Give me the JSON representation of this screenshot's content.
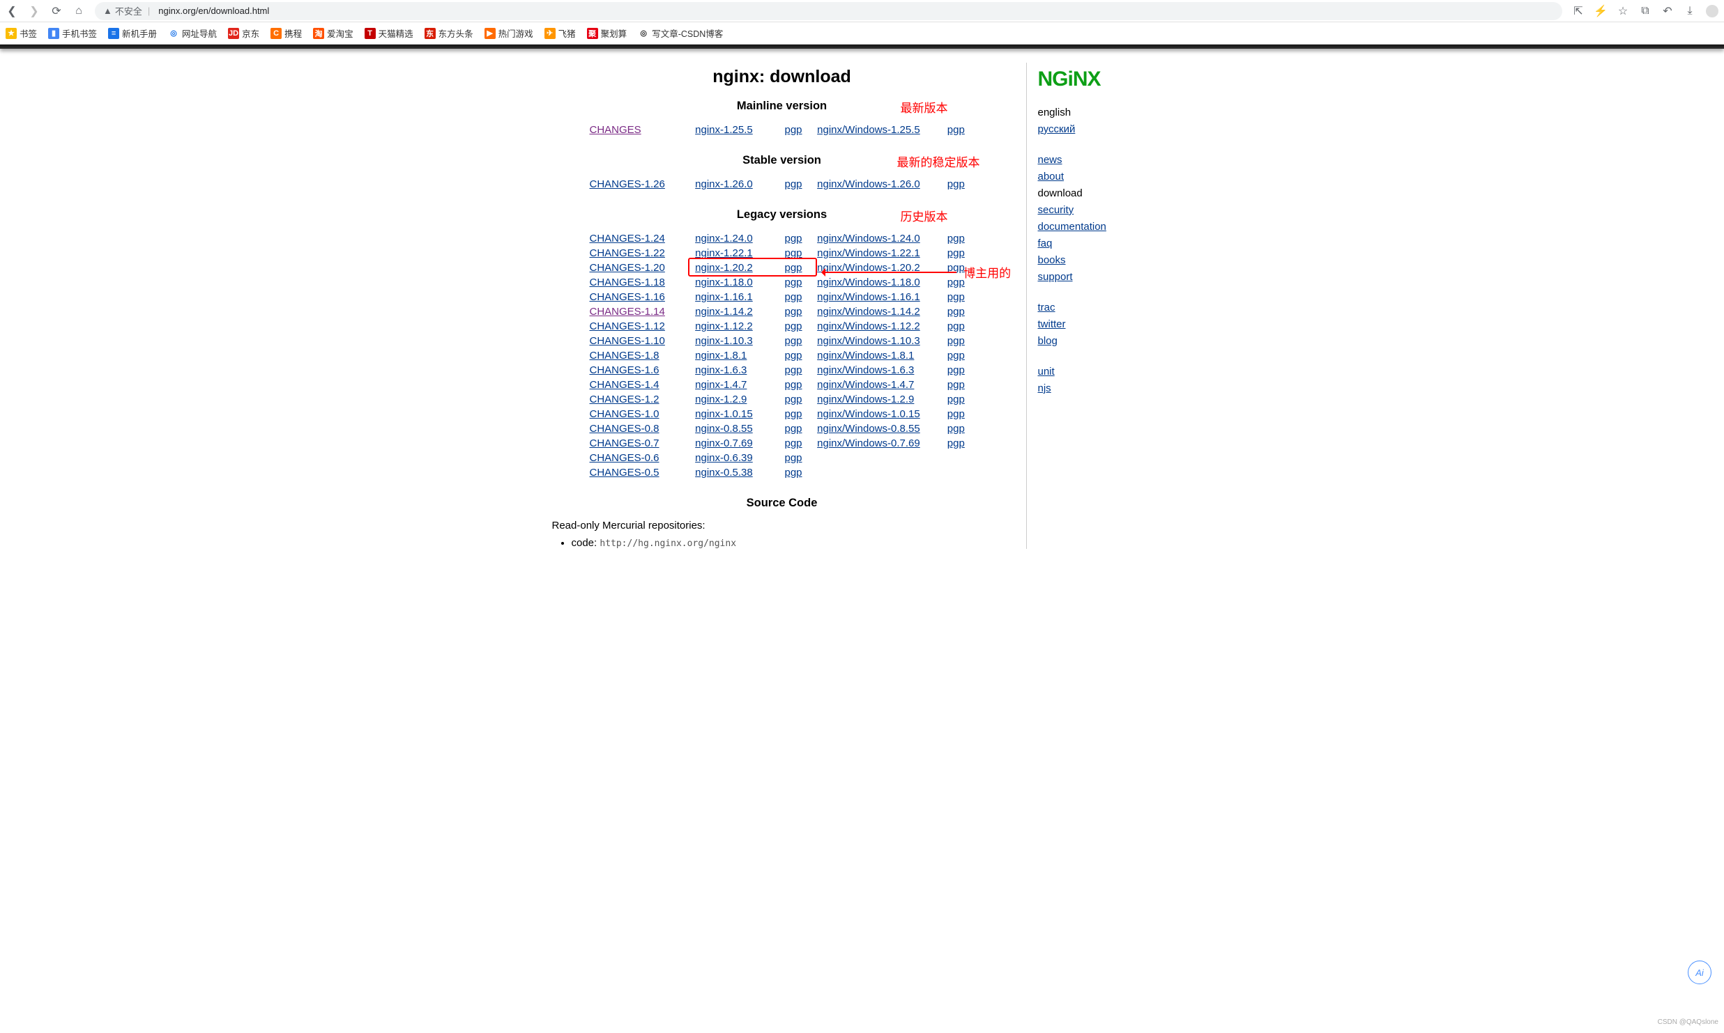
{
  "chrome": {
    "not_secure": "不安全",
    "url": "nginx.org/en/download.html"
  },
  "bookmarks": [
    {
      "label": "书签",
      "bg": "#fbbc04",
      "fg": "#fff",
      "g": "★"
    },
    {
      "label": "手机书签",
      "bg": "#4285f4",
      "fg": "#fff",
      "g": "▮"
    },
    {
      "label": "新机手册",
      "bg": "#1a73e8",
      "fg": "#fff",
      "g": "≡"
    },
    {
      "label": "网址导航",
      "bg": "#fff",
      "fg": "#1a73e8",
      "g": "◎"
    },
    {
      "label": "京东",
      "bg": "#e1251b",
      "fg": "#fff",
      "g": "JD"
    },
    {
      "label": "携程",
      "bg": "#ff6f00",
      "fg": "#fff",
      "g": "C"
    },
    {
      "label": "爱淘宝",
      "bg": "#ff5000",
      "fg": "#fff",
      "g": "淘"
    },
    {
      "label": "天猫精选",
      "bg": "#c40000",
      "fg": "#fff",
      "g": "T"
    },
    {
      "label": "东方头条",
      "bg": "#d81e06",
      "fg": "#fff",
      "g": "东"
    },
    {
      "label": "热门游戏",
      "bg": "#ff6a00",
      "fg": "#fff",
      "g": "▶"
    },
    {
      "label": "飞猪",
      "bg": "#ff9500",
      "fg": "#fff",
      "g": "✈"
    },
    {
      "label": "聚划算",
      "bg": "#e60012",
      "fg": "#fff",
      "g": "聚"
    },
    {
      "label": "写文章-CSDN博客",
      "bg": "#fff",
      "fg": "#333",
      "g": "◎"
    }
  ],
  "title": "nginx: download",
  "sections": {
    "mainline": {
      "h": "Mainline version",
      "annot": "最新版本"
    },
    "stable": {
      "h": "Stable version",
      "annot": "最新的稳定版本"
    },
    "legacy": {
      "h": "Legacy versions",
      "annot": "历史版本"
    },
    "source": {
      "h": "Source Code"
    }
  },
  "annot_box": "博主用的",
  "mainline": [
    {
      "chg": "CHANGES",
      "src": "nginx-1.25.5",
      "win": "nginx/Windows-1.25.5",
      "visited": true
    }
  ],
  "stable": [
    {
      "chg": "CHANGES-1.26",
      "src": "nginx-1.26.0",
      "win": "nginx/Windows-1.26.0"
    }
  ],
  "legacy": [
    {
      "chg": "CHANGES-1.24",
      "src": "nginx-1.24.0",
      "win": "nginx/Windows-1.24.0"
    },
    {
      "chg": "CHANGES-1.22",
      "src": "nginx-1.22.1",
      "win": "nginx/Windows-1.22.1"
    },
    {
      "chg": "CHANGES-1.20",
      "src": "nginx-1.20.2",
      "win": "nginx/Windows-1.20.2",
      "hl": true
    },
    {
      "chg": "CHANGES-1.18",
      "src": "nginx-1.18.0",
      "win": "nginx/Windows-1.18.0"
    },
    {
      "chg": "CHANGES-1.16",
      "src": "nginx-1.16.1",
      "win": "nginx/Windows-1.16.1"
    },
    {
      "chg": "CHANGES-1.14",
      "src": "nginx-1.14.2",
      "win": "nginx/Windows-1.14.2",
      "chg_visited": true
    },
    {
      "chg": "CHANGES-1.12",
      "src": "nginx-1.12.2",
      "win": "nginx/Windows-1.12.2"
    },
    {
      "chg": "CHANGES-1.10",
      "src": "nginx-1.10.3",
      "win": "nginx/Windows-1.10.3"
    },
    {
      "chg": "CHANGES-1.8",
      "src": "nginx-1.8.1",
      "win": "nginx/Windows-1.8.1"
    },
    {
      "chg": "CHANGES-1.6",
      "src": "nginx-1.6.3",
      "win": "nginx/Windows-1.6.3"
    },
    {
      "chg": "CHANGES-1.4",
      "src": "nginx-1.4.7",
      "win": "nginx/Windows-1.4.7"
    },
    {
      "chg": "CHANGES-1.2",
      "src": "nginx-1.2.9",
      "win": "nginx/Windows-1.2.9"
    },
    {
      "chg": "CHANGES-1.0",
      "src": "nginx-1.0.15",
      "win": "nginx/Windows-1.0.15"
    },
    {
      "chg": "CHANGES-0.8",
      "src": "nginx-0.8.55",
      "win": "nginx/Windows-0.8.55"
    },
    {
      "chg": "CHANGES-0.7",
      "src": "nginx-0.7.69",
      "win": "nginx/Windows-0.7.69"
    },
    {
      "chg": "CHANGES-0.6",
      "src": "nginx-0.6.39"
    },
    {
      "chg": "CHANGES-0.5",
      "src": "nginx-0.5.38"
    }
  ],
  "pgp": "pgp",
  "repo": {
    "intro": "Read-only Mercurial repositories:",
    "item_label": "code:",
    "item_url": "http://hg.nginx.org/nginx"
  },
  "side": {
    "logo": "NGiNX",
    "g1": [
      {
        "t": "english",
        "plain": true
      },
      {
        "t": "русский"
      }
    ],
    "g2": [
      {
        "t": "news"
      },
      {
        "t": "about"
      },
      {
        "t": "download",
        "plain": true
      },
      {
        "t": "security"
      },
      {
        "t": "documentation"
      },
      {
        "t": "faq"
      },
      {
        "t": "books"
      },
      {
        "t": "support"
      }
    ],
    "g3": [
      {
        "t": "trac"
      },
      {
        "t": "twitter"
      },
      {
        "t": "blog"
      }
    ],
    "g4": [
      {
        "t": "unit"
      },
      {
        "t": "njs"
      }
    ]
  },
  "watermark": "CSDN @QAQslone"
}
